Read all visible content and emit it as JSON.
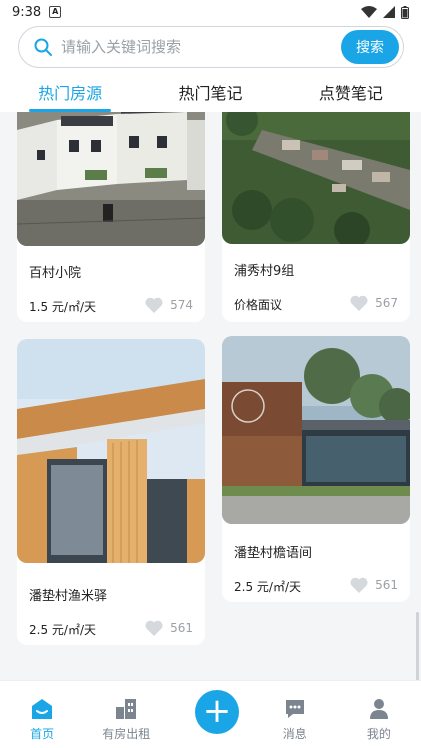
{
  "status_bar": {
    "time": "9:38",
    "notification_letter": "A"
  },
  "search": {
    "placeholder": "请输入关键词搜索",
    "button_label": "搜索"
  },
  "tabs": [
    {
      "label": "热门房源",
      "active": true
    },
    {
      "label": "热门笔记",
      "active": false
    },
    {
      "label": "点赞笔记",
      "active": false
    }
  ],
  "listings": [
    {
      "title": "百村小院",
      "price": "1.5 元/㎡/天",
      "likes": "574"
    },
    {
      "title": "浦秀村9组",
      "price": "价格面议",
      "likes": "567"
    },
    {
      "title": "潘垫村渔米驿",
      "price": "2.5 元/㎡/天",
      "likes": "561"
    },
    {
      "title": "潘垫村檐语间",
      "price": "2.5 元/㎡/天",
      "likes": "561"
    }
  ],
  "bottom_nav": [
    {
      "label": "首页",
      "icon": "home-icon",
      "active": true
    },
    {
      "label": "有房出租",
      "icon": "building-icon",
      "active": false
    },
    {
      "label": "",
      "icon": "plus-icon",
      "active": false
    },
    {
      "label": "消息",
      "icon": "message-icon",
      "active": false
    },
    {
      "label": "我的",
      "icon": "user-icon",
      "active": false
    }
  ],
  "colors": {
    "accent": "#1aa6e6",
    "muted": "#9aa0a6"
  }
}
